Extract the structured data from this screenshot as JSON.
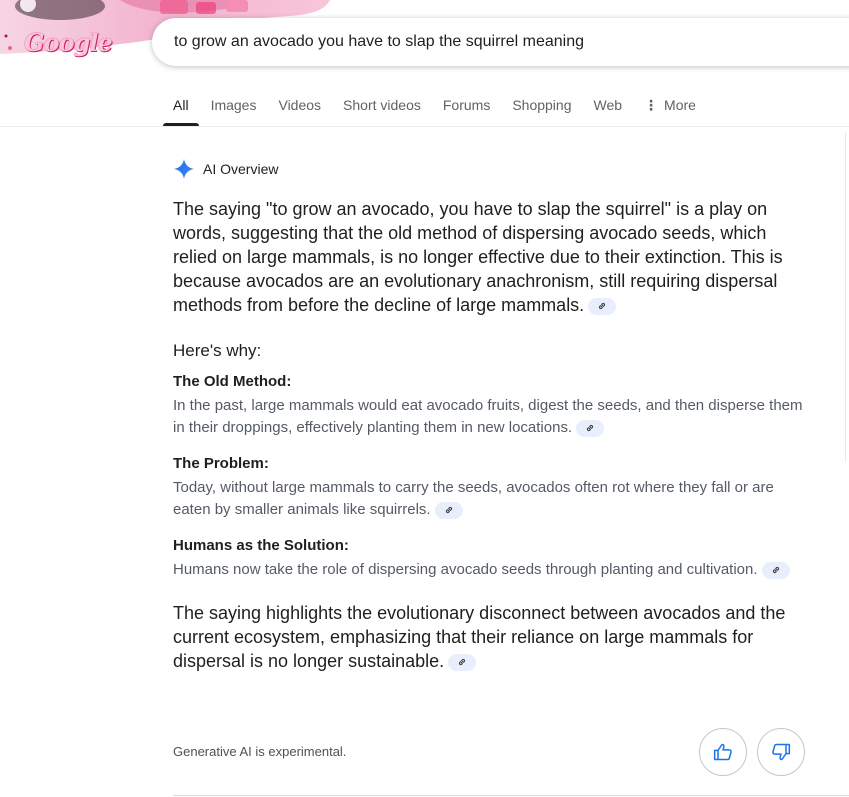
{
  "logo": {
    "text": "Google"
  },
  "search": {
    "query": "to grow an avocado you have to slap the squirrel meaning"
  },
  "tabs": [
    {
      "label": "All"
    },
    {
      "label": "Images"
    },
    {
      "label": "Videos"
    },
    {
      "label": "Short videos"
    },
    {
      "label": "Forums"
    },
    {
      "label": "Shopping"
    },
    {
      "label": "Web"
    },
    {
      "label": "More"
    }
  ],
  "ai_overview": {
    "title": "AI Overview",
    "lead": "The saying \"to grow an avocado, you have to slap the squirrel\" is a play on words, suggesting that the old method of dispersing avocado seeds, which relied on large mammals, is no longer effective due to their extinction. This is because avocados are an evolutionary anachronism, still requiring dispersal methods from before the decline of large mammals.",
    "why_heading": "Here's why:",
    "sections": [
      {
        "title": "The Old Method:",
        "body": "In the past, large mammals would eat avocado fruits, digest the seeds, and then disperse them in their droppings, effectively planting them in new locations."
      },
      {
        "title": "The Problem:",
        "body": "Today, without large mammals to carry the seeds, avocados often rot where they fall or are eaten by smaller animals like squirrels."
      },
      {
        "title": "Humans as the Solution:",
        "body": "Humans now take the role of dispersing avocado seeds through planting and cultivation."
      }
    ],
    "closing": "The saying highlights the evolutionary disconnect between avocados and the current ecosystem, emphasizing that their reliance on large mammals for dispersal is no longer sustainable.",
    "footer_note": "Generative AI is experimental."
  },
  "icons": {
    "spark": "ai-spark-icon",
    "link": "link-icon",
    "thumbs_up": "thumbs-up-icon",
    "thumbs_down": "thumbs-down-icon",
    "more_dots": "more-vert-icon"
  },
  "colors": {
    "accent": "#1a73e8",
    "chip_bg": "#e8eefb",
    "doodle_pink": "#f48fb1"
  }
}
